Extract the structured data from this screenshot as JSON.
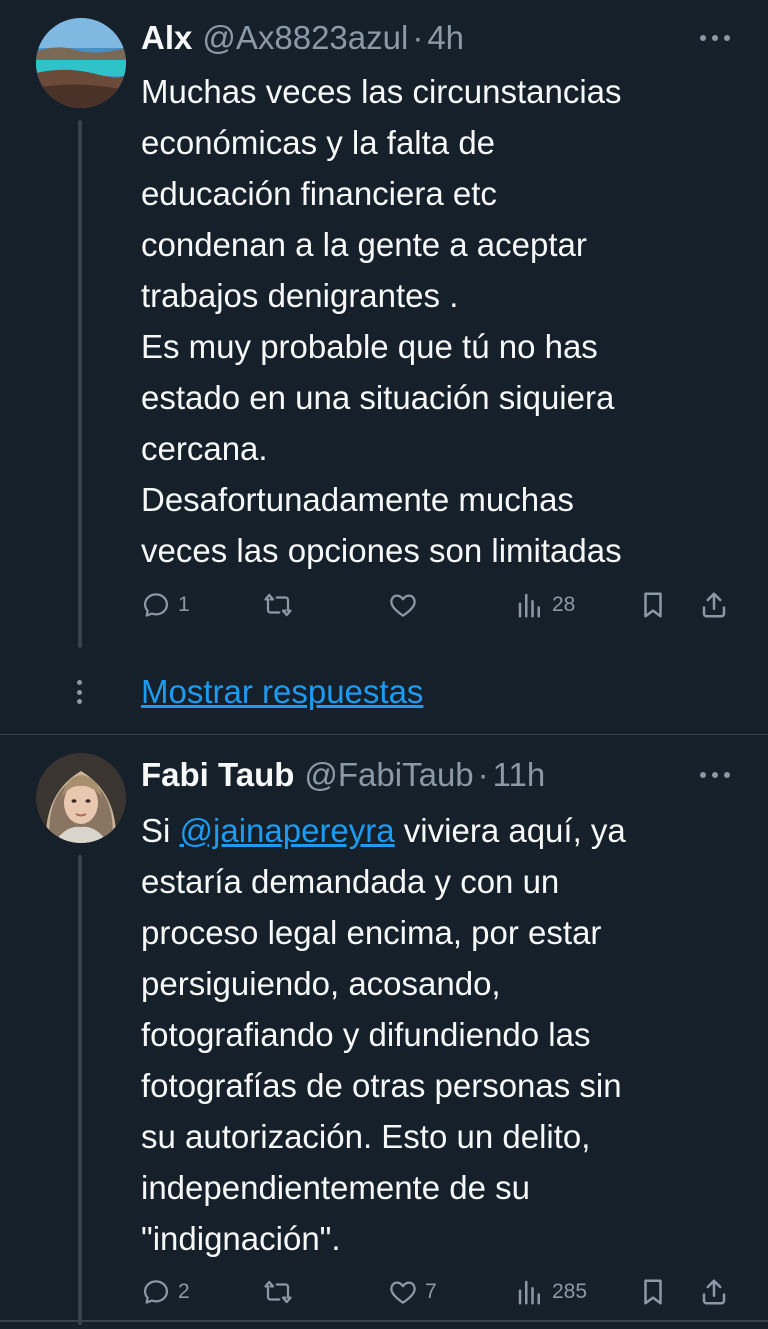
{
  "tweets": [
    {
      "name": "Alx",
      "handle": "@Ax8823azul",
      "separator": "·",
      "time": "4h",
      "lines": [
        "Muchas veces las circunstancias",
        "económicas y la falta de",
        "educación financiera etc",
        "condenan a la gente a aceptar",
        "trabajos denigrantes .",
        "Es muy probable que tú no has",
        "estado en una situación siquiera",
        "cercana.",
        "Desafortunadamente muchas",
        "veces las opciones son limitadas"
      ],
      "replies": "1",
      "retweets": "",
      "likes": "",
      "views": "28",
      "avatar_icon": "landscape-avatar"
    },
    {
      "name": "Fabi Taub",
      "handle": "@FabiTaub",
      "separator": "·",
      "time": "11h",
      "line1_prefix": "Si ",
      "mention": "@jainapereyra",
      "line1_suffix": " viviera aquí, ya",
      "lines": [
        "estaría demandada y con un",
        "proceso legal encima, por estar",
        "persiguiendo, acosando,",
        "fotografiando y difundiendo las",
        "fotografías de otras personas sin",
        "su autorización. Esto un delito,",
        "independientemente de su",
        "\"indignación\"."
      ],
      "replies": "2",
      "retweets": "",
      "likes": "7",
      "views": "285",
      "avatar_icon": "woman-portrait-avatar"
    }
  ],
  "show_replies_label": "Mostrar respuestas",
  "colors": {
    "background": "#15202b",
    "text": "#f7f9f9",
    "secondary": "#8b98a5",
    "accent": "#1d9bf0",
    "divider": "#38444d"
  }
}
